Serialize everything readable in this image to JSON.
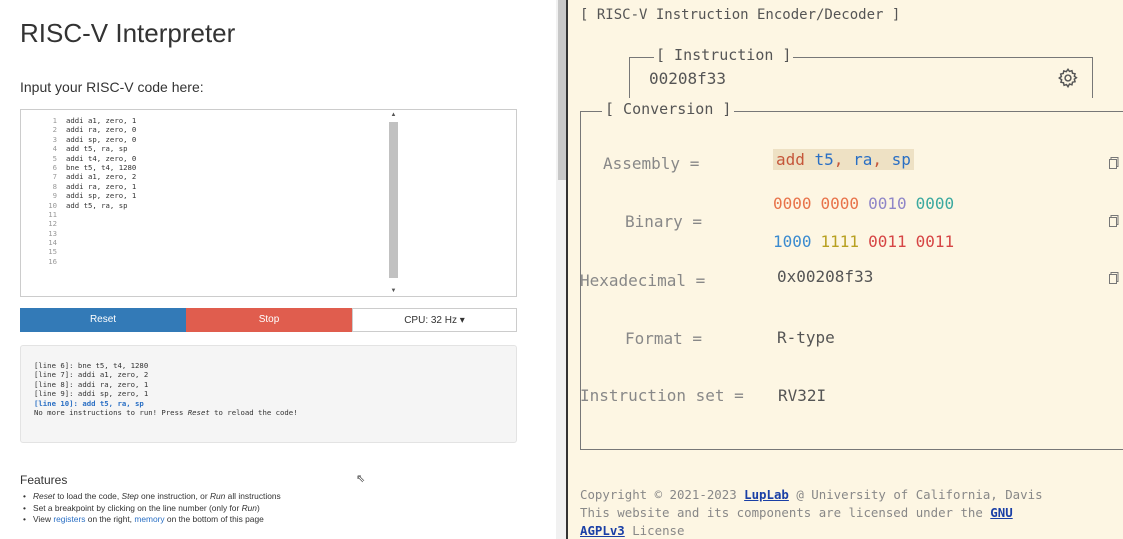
{
  "left": {
    "title": "RISC-V Interpreter",
    "prompt": "Input your RISC-V code here:",
    "line_numbers": [
      "1",
      "2",
      "3",
      "4",
      "5",
      "6",
      "7",
      "8",
      "9",
      "10",
      "11",
      "12",
      "13",
      "14",
      "15",
      "16"
    ],
    "code_lines": [
      "addi a1, zero, 1",
      "addi ra, zero, 0",
      "addi sp, zero, 0",
      "add t5, ra, sp",
      "addi t4, zero, 0",
      "bne t5, t4, 1280",
      "addi a1, zero, 2",
      "addi ra, zero, 1",
      "addi sp, zero, 1",
      "add t5, ra, sp"
    ],
    "buttons": {
      "reset": "Reset",
      "stop": "Stop",
      "cpu": "CPU: 32 Hz ▾"
    },
    "console": {
      "lines": [
        "[line 6]: bne t5, t4, 1280",
        "[line 7]: addi a1, zero, 2",
        "[line 8]: addi ra, zero, 1",
        "[line 9]: addi sp, zero, 1"
      ],
      "highlight": "[line 10]: add t5, ra, sp",
      "msg_pre": "No more instructions to run! Press ",
      "msg_em": "Reset",
      "msg_post": " to reload the code!"
    },
    "features": {
      "title": "Features",
      "item1": {
        "a": "Reset",
        "b": " to load the code, ",
        "c": "Step",
        "d": " one instruction, or ",
        "e": "Run",
        "f": " all instructions"
      },
      "item2": {
        "a": "Set a breakpoint by clicking on the line number (only for ",
        "b": "Run",
        "c": ")"
      },
      "item3": {
        "a": "View ",
        "b": "registers",
        "c": " on the right, ",
        "d": "memory",
        "e": " on the bottom of this page"
      }
    }
  },
  "right": {
    "title": "[ RISC-V Instruction Encoder/Decoder ]",
    "instruction_legend": "[ Instruction ]",
    "instruction_value": "00208f33",
    "conversion_legend": "[ Conversion ]",
    "assembly_label": "Assembly =",
    "assembly": {
      "op": "add ",
      "r1": "t5",
      "s1": ", ",
      "r2": "ra",
      "s2": ", ",
      "r3": "sp"
    },
    "binary_label": "Binary =",
    "binary_row1": [
      "0000",
      "0000",
      "0010",
      "0000"
    ],
    "binary_row2": [
      "1000",
      "1111",
      "0011",
      "0011"
    ],
    "hex_label": "Hexadecimal =",
    "hex_value": "0x00208f33",
    "format_label": "Format =",
    "format_value": "R-type",
    "iset_label": "Instruction set =",
    "iset_value": "RV32I",
    "footer": {
      "l1_pre": "Copyright © 2021-2023 ",
      "l1_link": "LupLab",
      "l1_post": " @ University of California, Davis",
      "l2_pre": "This website and its components are licensed under the ",
      "l2_link": "GNU",
      "l3_link": "AGPLv3",
      "l3_post": " License"
    },
    "colors": {
      "background": "#fdf6e3",
      "opcode": "#c5563a",
      "register": "#2a6fc4"
    }
  }
}
